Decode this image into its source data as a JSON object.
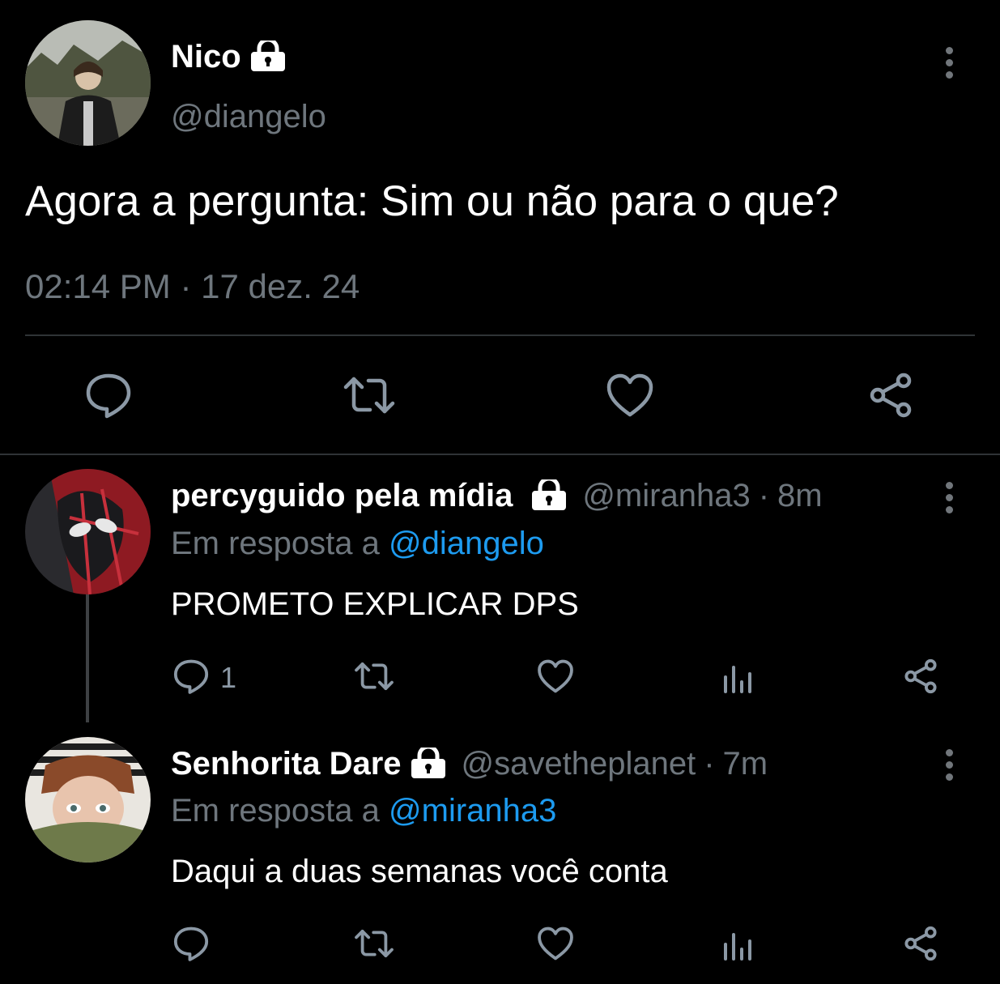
{
  "main_tweet": {
    "display_name": "Nico",
    "handle": "@diangelo",
    "text": "Agora a pergunta: Sim ou não para o que?",
    "timestamp": "02:14 PM · 17 dez. 24",
    "avatar_icon": "avatar-photo",
    "actions": [
      "reply-icon",
      "retweet-icon",
      "like-icon",
      "share-icon"
    ]
  },
  "replies": [
    {
      "display_name": "percyguido pela mídia",
      "handle": "@miranha3",
      "time": "8m",
      "reply_prefix": "Em resposta a",
      "reply_to": "@diangelo",
      "text": "PROMETO EXPLICAR DPS",
      "reply_count": "1",
      "avatar_icon": "avatar-photo"
    },
    {
      "display_name": "Senhorita Dare",
      "handle": "@savetheplanet",
      "time": "7m",
      "reply_prefix": "Em resposta a",
      "reply_to": "@miranha3",
      "text": "Daqui a duas semanas você conta",
      "reply_count": "",
      "avatar_icon": "avatar-photo"
    }
  ],
  "colors": {
    "background": "#000000",
    "text": "#e7e9ea",
    "muted": "#6e767d",
    "link": "#1d9bf0",
    "icon": "#8b98a5",
    "divider": "#2f3336"
  }
}
